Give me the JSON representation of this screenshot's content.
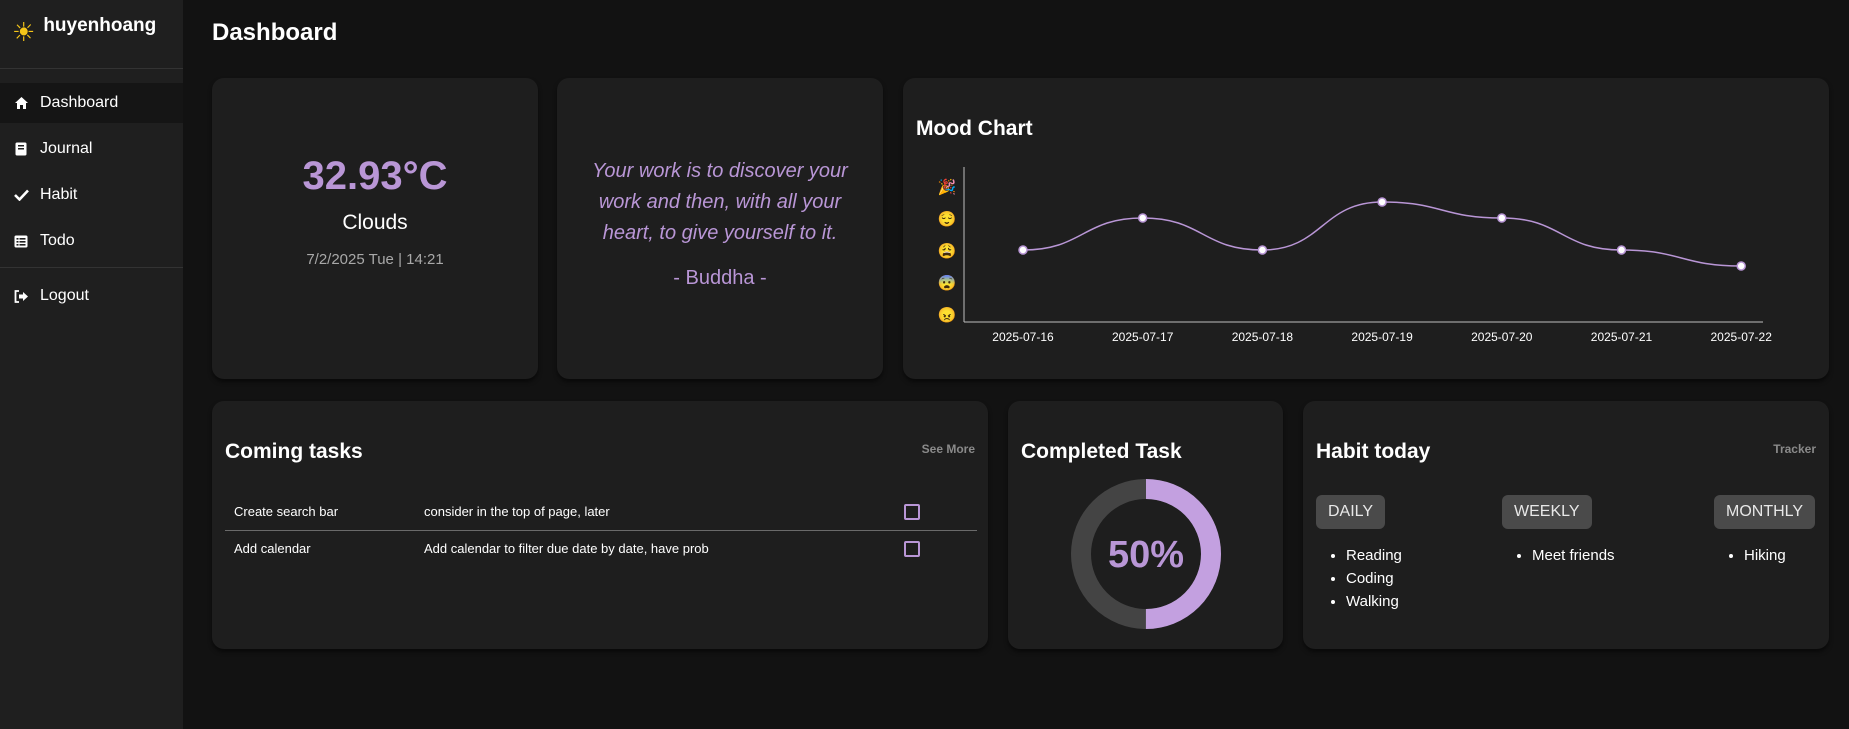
{
  "brand": {
    "name": "huyenhoang",
    "icon": "sun-icon",
    "icon_color": "#f5c518"
  },
  "nav": {
    "items": [
      {
        "label": "Dashboard",
        "icon": "home-icon"
      },
      {
        "label": "Journal",
        "icon": "book-icon"
      },
      {
        "label": "Habit",
        "icon": "check-icon"
      },
      {
        "label": "Todo",
        "icon": "list-icon"
      }
    ],
    "logout": {
      "label": "Logout",
      "icon": "logout-icon"
    }
  },
  "page": {
    "title": "Dashboard"
  },
  "weather": {
    "temperature": "32.93°C",
    "condition": "Clouds",
    "date": "7/2/2025",
    "day": "Tue",
    "time": "14:21"
  },
  "quote": {
    "text": "Your work is to discover your work and then, with all your heart, to give yourself to it.",
    "author": "- Buddha -"
  },
  "mood": {
    "title": "Mood Chart",
    "chart_data": {
      "type": "line",
      "x": [
        "2025-07-16",
        "2025-07-17",
        "2025-07-18",
        "2025-07-19",
        "2025-07-20",
        "2025-07-21",
        "2025-07-22"
      ],
      "y_levels": [
        "😠",
        "😨",
        "😩",
        "😌",
        "🎉"
      ],
      "values": [
        2,
        3,
        2,
        3.5,
        3,
        2,
        1.5
      ],
      "ylim": [
        0,
        4
      ],
      "line_color": "#b996d6"
    }
  },
  "tasks": {
    "title": "Coming tasks",
    "see_more": "See More",
    "rows": [
      {
        "name": "Create search bar",
        "description": "consider in the top of page, later",
        "done": false
      },
      {
        "name": "Add calendar",
        "description": "Add calendar to filter due date by date, have prob",
        "done": false
      }
    ]
  },
  "completed": {
    "title": "Completed Task",
    "label": "50%",
    "chart_data": {
      "type": "pie",
      "values": [
        50,
        50
      ],
      "colors": [
        "#c3a0e0",
        "#444444"
      ]
    }
  },
  "habit": {
    "title": "Habit today",
    "tracker": "Tracker",
    "groups": [
      {
        "label": "DAILY",
        "items": [
          "Reading",
          "Coding",
          "Walking"
        ]
      },
      {
        "label": "WEEKLY",
        "items": [
          "Meet friends"
        ]
      },
      {
        "label": "MONTHLY",
        "items": [
          "Hiking"
        ]
      }
    ]
  },
  "colors": {
    "accent": "#b996d6",
    "background": "#121212",
    "card": "#1e1e1e",
    "sidebar": "#1f1f1f"
  }
}
